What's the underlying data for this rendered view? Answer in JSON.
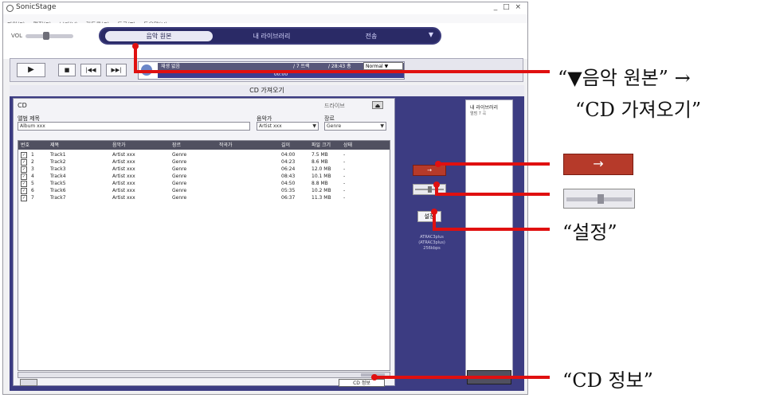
{
  "app": {
    "title": "SonicStage",
    "window_controls": "_ □ ×"
  },
  "menu": [
    "파일(F)",
    "편집(E)",
    "보기(V)",
    "컨트롤(C)",
    "도구(T)",
    "도움말(H)"
  ],
  "volume_label": "VOL",
  "nav": {
    "items": [
      "음악 원본",
      "내 라이브러리",
      "전송"
    ],
    "selected": "음악 원본",
    "arrow": "▼"
  },
  "player": {
    "buttons": [
      "▶",
      "■",
      "|◀◀",
      "▶▶|"
    ],
    "info_line1": "재생 없음",
    "info_line2": "00:00",
    "track_count": "/ 7 트랙",
    "total_time": "/ 28:43 총",
    "mode": "Normal"
  },
  "panel_title": "CD 가져오기",
  "cd": {
    "label": "CD",
    "refresh": "드라이브",
    "eject": "⏏",
    "album_label": "앨범 제목",
    "album_value": "Album xxx",
    "artist_label": "음악가",
    "artist_value": "Artist xxx",
    "genre_label": "장르",
    "genre_value": "Genre",
    "columns": [
      "번호",
      "제목",
      "음악가",
      "장르",
      "작곡가",
      "길이",
      "파일 크기",
      "상태"
    ],
    "tracks": [
      {
        "no": "1",
        "title": "Track1",
        "artist": "Artist xxx",
        "genre": "Genre",
        "length": "04:00",
        "size": "7.5 MB",
        "status": "-"
      },
      {
        "no": "2",
        "title": "Track2",
        "artist": "Artist xxx",
        "genre": "Genre",
        "length": "04:23",
        "size": "8.6 MB",
        "status": "-"
      },
      {
        "no": "3",
        "title": "Track3",
        "artist": "Artist xxx",
        "genre": "Genre",
        "length": "06:24",
        "size": "12.0 MB",
        "status": "-"
      },
      {
        "no": "4",
        "title": "Track4",
        "artist": "Artist xxx",
        "genre": "Genre",
        "length": "08:43",
        "size": "10.1 MB",
        "status": "-"
      },
      {
        "no": "5",
        "title": "Track5",
        "artist": "Artist xxx",
        "genre": "Genre",
        "length": "04:50",
        "size": "8.8 MB",
        "status": "-"
      },
      {
        "no": "6",
        "title": "Track6",
        "artist": "Artist xxx",
        "genre": "Genre",
        "length": "05:35",
        "size": "10.2 MB",
        "status": "-"
      },
      {
        "no": "7",
        "title": "Track7",
        "artist": "Artist xxx",
        "genre": "Genre",
        "length": "06:37",
        "size": "11.3 MB",
        "status": "-"
      }
    ],
    "cd_info_button": "CD 정보"
  },
  "transfer": {
    "arrow_button": "→",
    "settings_button": "설정",
    "format_text": "ATRAC3plus\n(ATRAC3plus)\n256kbps"
  },
  "library": {
    "title": "내 라이브러리",
    "subtitle": "앨범 7 곡"
  },
  "callouts": {
    "music_source": "“▼음악 원본” →",
    "cd_import": "“CD 가져오기”",
    "settings": "“설정”",
    "cd_info": "“CD 정보”"
  },
  "callout_color": "#e01010"
}
